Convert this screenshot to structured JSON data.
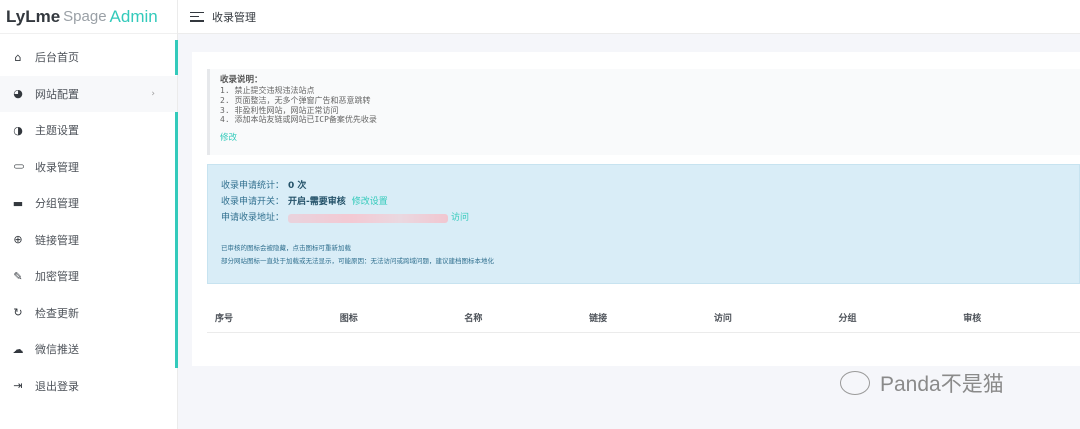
{
  "logo": {
    "part1": "LyLme",
    "part2": "Spage",
    "part3": "Admin"
  },
  "header": {
    "title": "收录管理"
  },
  "sidebar": {
    "items": [
      {
        "label": "后台首页",
        "icon": "home-icon",
        "glyph": "⌂"
      },
      {
        "label": "网站配置",
        "icon": "palette-icon",
        "glyph": "◕",
        "chevron": "›"
      },
      {
        "label": "主题设置",
        "icon": "contrast-icon",
        "glyph": "◑"
      },
      {
        "label": "收录管理",
        "icon": "link-icon",
        "glyph": "⊂⊃"
      },
      {
        "label": "分组管理",
        "icon": "folder-icon",
        "glyph": "▬"
      },
      {
        "label": "链接管理",
        "icon": "globe-icon",
        "glyph": "⊕"
      },
      {
        "label": "加密管理",
        "icon": "wrench-icon",
        "glyph": "✎"
      },
      {
        "label": "检查更新",
        "icon": "refresh-icon",
        "glyph": "↻"
      },
      {
        "label": "微信推送",
        "icon": "wechat-icon",
        "glyph": "☁"
      },
      {
        "label": "退出登录",
        "icon": "logout-icon",
        "glyph": "⇥"
      }
    ]
  },
  "notice": {
    "title": "收录说明：",
    "lines": [
      "1. 禁止提交违规违法站点",
      "2. 页面整洁，无多个弹窗广告和恶意跳转",
      "3. 非盈利性网站，网站正常访问",
      "4. 添加本站友链或网站已ICP备案优先收录"
    ],
    "edit": "修改"
  },
  "info": {
    "count_label": "收录申请统计：",
    "count_value": "0 次",
    "switch_label": "收录申请开关：",
    "switch_value": "开启-需要审核",
    "switch_link": "修改设置",
    "url_label": "申请收录地址：",
    "url_link": "访问",
    "note1": "已审核的图标会被隐藏，点击图标可重新加载",
    "note2": "部分网站图标一直处于加载或无法显示，可能原因：无法访问或跨域问题，建议建档图标本地化"
  },
  "table": {
    "headers": [
      "序号",
      "图标",
      "名称",
      "链接",
      "访问",
      "分组",
      "审核"
    ]
  },
  "watermark": "Panda不是猫",
  "colors": {
    "accent": "#33cabb",
    "info_bg": "#d9edf7"
  }
}
